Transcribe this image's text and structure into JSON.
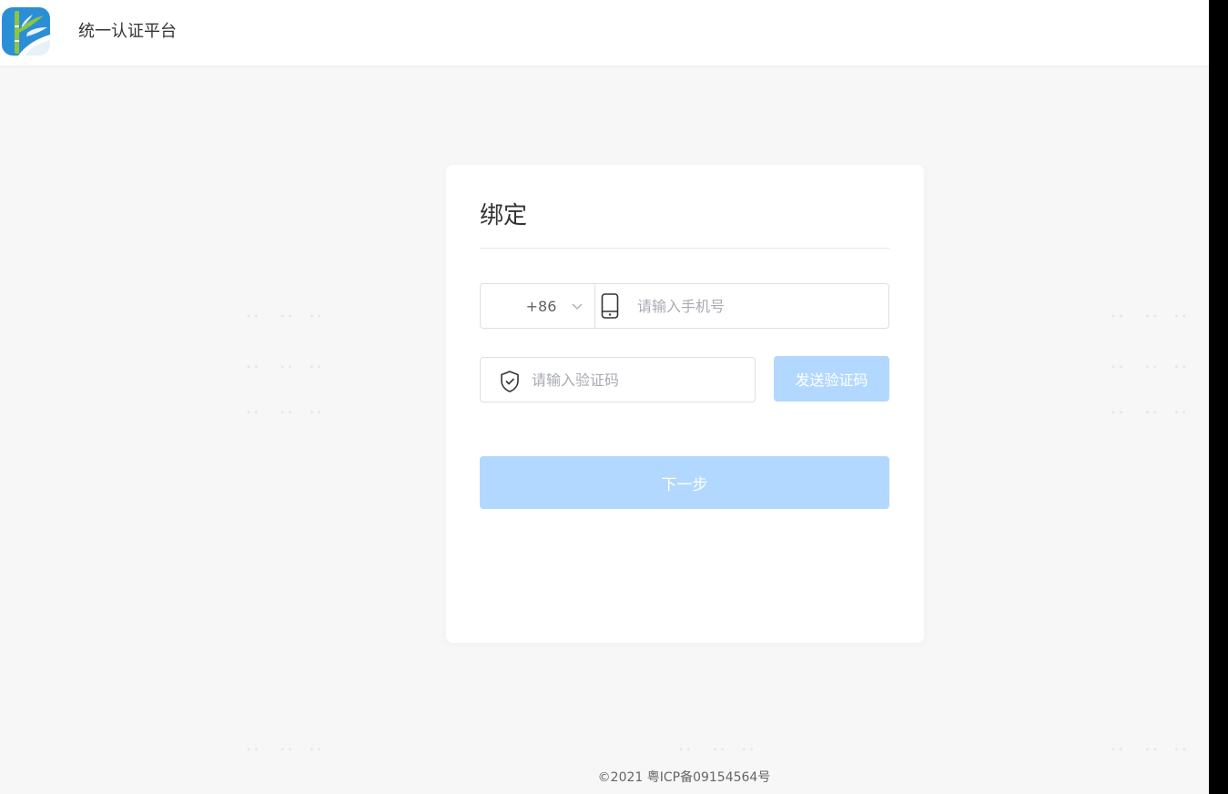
{
  "header": {
    "title": "统一认证平台",
    "logo_icon": "bamboo-logo-icon"
  },
  "card": {
    "title": "绑定",
    "phone": {
      "country_code": "+86",
      "placeholder": "请输入手机号",
      "value": ""
    },
    "verification": {
      "placeholder": "请输入验证码",
      "value": "",
      "send_label": "发送验证码"
    },
    "next_label": "下一步"
  },
  "footer": {
    "text": "©2021 粤ICP备09154564号"
  },
  "colors": {
    "page_bg": "#f7f7f7",
    "button_disabled": "#b3d8ff",
    "border": "#dcdfe6",
    "logo_blue": "#2b8fd6",
    "logo_green": "#8cc63f"
  }
}
